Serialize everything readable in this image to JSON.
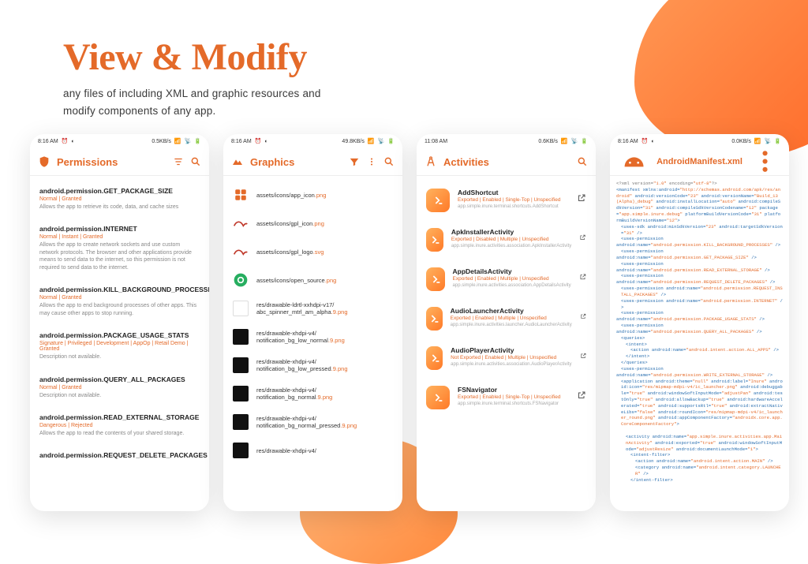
{
  "heading": "View & Modify",
  "subhead_line1": "any files of including XML and graphic resources and",
  "subhead_line2": "modify components of any app.",
  "status": {
    "time1": "8:16 AM",
    "time2": "8:16 AM",
    "time3": "11:08 AM",
    "time4": "8:16 AM",
    "speed1": "0.5KB/s",
    "speed2": "49.8KB/s",
    "speed3": "0.6KB/s",
    "speed4": "0.0KB/s"
  },
  "phone1": {
    "title": "Permissions",
    "items": [
      {
        "title": "android.permission.GET_PACKAGE_SIZE",
        "status": "Normal | Granted",
        "desc": "Allows the app to retrieve its code, data, and cache sizes"
      },
      {
        "title": "android.permission.INTERNET",
        "status": "Normal | Instant | Granted",
        "desc": "Allows the app to create network sockets and use custom network protocols. The browser and other applications provide means to send data to the internet, so this permission is not required to send data to the internet."
      },
      {
        "title": "android.permission.KILL_BACKGROUND_PROCESSES",
        "status": "Normal | Granted",
        "desc": "Allows the app to end background processes of other apps. This may cause other apps to stop running."
      },
      {
        "title": "android.permission.PACKAGE_USAGE_STATS",
        "status": "Signature | Privileged | Development | AppOp | Retail Demo | Granted",
        "desc": "Description not available."
      },
      {
        "title": "android.permission.QUERY_ALL_PACKAGES",
        "status": "Normal | Granted",
        "desc": "Description not available."
      },
      {
        "title": "android.permission.READ_EXTERNAL_STORAGE",
        "status": "Dangerous | Rejected",
        "desc": "Allows the app to read the contents of your shared storage."
      },
      {
        "title": "android.permission.REQUEST_DELETE_PACKAGES",
        "status": "",
        "desc": ""
      }
    ]
  },
  "phone2": {
    "title": "Graphics",
    "items": [
      {
        "thumb": "grid",
        "base": "assets/icons/app_icon",
        "ext": ".png",
        "nine": false
      },
      {
        "thumb": "bird",
        "base": "assets/icons/gpl_icon",
        "ext": ".png",
        "nine": false
      },
      {
        "thumb": "bird",
        "base": "assets/icons/gpl_logo",
        "ext": ".svg",
        "nine": false
      },
      {
        "thumb": "green",
        "base": "assets/icons/open_source",
        "ext": ".png",
        "nine": false
      },
      {
        "thumb": "empty",
        "base": "res/drawable-ldrtl-xxhdpi-v17/ abc_spinner_mtrl_am_alpha",
        "ext": ".png",
        "nine": true
      },
      {
        "thumb": "black",
        "base": "res/drawable-xhdpi-v4/ notification_bg_low_normal",
        "ext": ".png",
        "nine": true
      },
      {
        "thumb": "black",
        "base": "res/drawable-xhdpi-v4/ notification_bg_low_pressed",
        "ext": ".png",
        "nine": true
      },
      {
        "thumb": "black",
        "base": "res/drawable-xhdpi-v4/ notification_bg_normal",
        "ext": ".png",
        "nine": true
      },
      {
        "thumb": "black",
        "base": "res/drawable-xhdpi-v4/ notification_bg_normal_pressed",
        "ext": ".png",
        "nine": true
      },
      {
        "thumb": "black",
        "base": "res/drawable-xhdpi-v4/",
        "ext": "",
        "nine": false
      }
    ]
  },
  "phone3": {
    "title": "Activities",
    "items": [
      {
        "title": "AddShortcut",
        "status": "Exported | Enabled | Single-Top | Unspecified",
        "path": "app.simple.inure.terminal.shortcuts.AddShortcut"
      },
      {
        "title": "ApkInstallerActivity",
        "status": "Exported | Disabled | Multiple | Unspecified",
        "path": "app.simple.inure.activities.association.ApkInstallerActivity"
      },
      {
        "title": "AppDetailsActivity",
        "status": "Exported | Enabled | Multiple | Unspecified",
        "path": "app.simple.inure.activities.association.AppDetailsActivity"
      },
      {
        "title": "AudioLauncherActivity",
        "status": "Exported | Enabled | Multiple | Unspecified",
        "path": "app.simple.inure.activities.launcher.AudioLauncherActivity"
      },
      {
        "title": "AudioPlayerActivity",
        "status": "Not Exported | Enabled | Multiple | Unspecified",
        "path": "app.simple.inure.activities.association.AudioPlayerActivity"
      },
      {
        "title": "FSNavigator",
        "status": "Exported | Enabled | Single-Top | Unspecified",
        "path": "app.simple.inure.terminal.shortcuts.FSNavigator"
      }
    ]
  },
  "phone4": {
    "title": "AndroidManifest.xml",
    "xml": [
      {
        "indent": 0,
        "html": "<span class='xml-plain'>&lt;?xml version=</span><span class='xml-val'>\"1.0\"</span><span class='xml-plain'> encoding=</span><span class='xml-val'>\"utf-8\"</span><span class='xml-plain'>?&gt;</span>"
      },
      {
        "indent": 0,
        "html": "<span class='xml-tag'>&lt;manifest</span> <span class='xml-attr'>xmlns:android=</span><span class='xml-val'>\"http://schemas.android.com/apk/res/android\"</span> <span class='xml-attr'>android:versionCode=</span><span class='xml-val'>\"23\"</span> <span class='xml-attr'>android:versionName=</span><span class='xml-val'>\"Build_13 (Alpha)_debug\"</span> <span class='xml-attr'>android:installLocation=</span><span class='xml-val'>\"auto\"</span> <span class='xml-attr'>android:compileSdkVersion=</span><span class='xml-val'>\"31\"</span> <span class='xml-attr'>android:compileSdkVersionCodename=</span><span class='xml-val'>\"12\"</span> <span class='xml-attr'>package=</span><span class='xml-val'>\"app.simple.inure.debug\"</span> <span class='xml-attr'>platformBuildVersionCode=</span><span class='xml-val'>\"31\"</span> <span class='xml-attr'>platformBuildVersionName=</span><span class='xml-val'>\"12\"</span><span class='xml-tag'>&gt;</span>"
      },
      {
        "indent": 1,
        "html": "<span class='xml-tag'>&lt;uses-sdk</span> <span class='xml-attr'>android:minSdkVersion=</span><span class='xml-val'>\"23\"</span> <span class='xml-attr'>android:targetSdkVersion=</span><span class='xml-val'>\"31\"</span> <span class='xml-tag'>/&gt;</span>"
      },
      {
        "indent": 1,
        "html": "<span class='xml-tag'>&lt;uses-permission</span>"
      },
      {
        "indent": 0,
        "html": "<span class='xml-attr'>android:name=</span><span class='xml-val'>\"android.permission.KILL_BACKGROUND_PROCESSES\"</span> <span class='xml-tag'>/&gt;</span>"
      },
      {
        "indent": 1,
        "html": "<span class='xml-tag'>&lt;uses-permission</span>"
      },
      {
        "indent": 0,
        "html": "<span class='xml-attr'>android:name=</span><span class='xml-val'>\"android.permission.GET_PACKAGE_SIZE\"</span> <span class='xml-tag'>/&gt;</span>"
      },
      {
        "indent": 1,
        "html": "<span class='xml-tag'>&lt;uses-permission</span>"
      },
      {
        "indent": 0,
        "html": "<span class='xml-attr'>android:name=</span><span class='xml-val'>\"android.permission.READ_EXTERNAL_STORAGE\"</span> <span class='xml-tag'>/&gt;</span>"
      },
      {
        "indent": 1,
        "html": "<span class='xml-tag'>&lt;uses-permission</span>"
      },
      {
        "indent": 0,
        "html": "<span class='xml-attr'>android:name=</span><span class='xml-val'>\"android.permission.REQUEST_DELETE_PACKAGES\"</span> <span class='xml-tag'>/&gt;</span>"
      },
      {
        "indent": 1,
        "html": "<span class='xml-tag'>&lt;uses-permission</span> <span class='xml-attr'>android:name=</span><span class='xml-val'>\"android.permission.REQUEST_INSTALL_PACKAGES\"</span> <span class='xml-tag'>/&gt;</span>"
      },
      {
        "indent": 1,
        "html": "<span class='xml-tag'>&lt;uses-permission</span> <span class='xml-attr'>android:name=</span><span class='xml-val'>\"android.permission.INTERNET\"</span> <span class='xml-tag'>/&gt;</span>"
      },
      {
        "indent": 1,
        "html": "<span class='xml-tag'>&lt;uses-permission</span>"
      },
      {
        "indent": 0,
        "html": "<span class='xml-attr'>android:name=</span><span class='xml-val'>\"android.permission.PACKAGE_USAGE_STATS\"</span> <span class='xml-tag'>/&gt;</span>"
      },
      {
        "indent": 1,
        "html": "<span class='xml-tag'>&lt;uses-permission</span>"
      },
      {
        "indent": 0,
        "html": "<span class='xml-attr'>android:name=</span><span class='xml-val'>\"android.permission.QUERY_ALL_PACKAGES\"</span> <span class='xml-tag'>/&gt;</span>"
      },
      {
        "indent": 1,
        "html": "<span class='xml-tag'>&lt;queries&gt;</span>"
      },
      {
        "indent": 2,
        "html": "<span class='xml-tag'>&lt;intent&gt;</span>"
      },
      {
        "indent": 3,
        "html": "<span class='xml-tag'>&lt;action</span> <span class='xml-attr'>android:name=</span><span class='xml-val'>\"android.intent.action.ALL_APPS\"</span> <span class='xml-tag'>/&gt;</span>"
      },
      {
        "indent": 2,
        "html": "<span class='xml-tag'>&lt;/intent&gt;</span>"
      },
      {
        "indent": 1,
        "html": "<span class='xml-tag'>&lt;/queries&gt;</span>"
      },
      {
        "indent": 1,
        "html": "<span class='xml-tag'>&lt;uses-permission</span>"
      },
      {
        "indent": 0,
        "html": "<span class='xml-attr'>android:name=</span><span class='xml-val'>\"android.permission.WRITE_EXTERNAL_STORAGE\"</span> <span class='xml-tag'>/&gt;</span>"
      },
      {
        "indent": 1,
        "html": "<span class='xml-tag'>&lt;application</span> <span class='xml-attr'>android:theme=</span><span class='xml-val'>\"null\"</span> <span class='xml-attr'>android:label=</span><span class='xml-val'>\"Inure\"</span> <span class='xml-attr'>android:icon=</span><span class='xml-val'>\"res/mipmap-mdpi-v4/ic_launcher.png\"</span> <span class='xml-attr'>android:debuggable=</span><span class='xml-val'>\"true\"</span> <span class='xml-attr'>android:windowSoftInputMode=</span><span class='xml-val'>\"adjustPan\"</span> <span class='xml-attr'>android:testOnly=</span><span class='xml-val'>\"true\"</span> <span class='xml-attr'>android:allowBackup=</span><span class='xml-val'>\"true\"</span> <span class='xml-attr'>android:hardwareAccelerated=</span><span class='xml-val'>\"true\"</span> <span class='xml-attr'>android:supportsRtl=</span><span class='xml-val'>\"true\"</span> <span class='xml-attr'>android:extractNativeLibs=</span><span class='xml-val'>\"false\"</span> <span class='xml-attr'>android:roundIcon=</span><span class='xml-val'>\"res/mipmap-mdpi-v4/ic_launcher_round.png\"</span> <span class='xml-attr'>android:appComponentFactory=</span><span class='xml-val'>\"androidx.core.app.CoreComponentFactory\"</span><span class='xml-tag'>&gt;</span>"
      },
      {
        "indent": 0,
        "html": "&nbsp;"
      },
      {
        "indent": 2,
        "html": "<span class='xml-tag'>&lt;activity</span> <span class='xml-attr'>android:name=</span><span class='xml-val'>\"app.simple.inure.activities.app.MainActivity\"</span> <span class='xml-attr'>android:exported=</span><span class='xml-val'>\"true\"</span> <span class='xml-attr'>android:windowSoftInputMode=</span><span class='xml-val'>\"adjustResize\"</span> <span class='xml-attr'>android:documentLaunchMode=</span><span class='xml-val'>\"1\"</span><span class='xml-tag'>&gt;</span>"
      },
      {
        "indent": 3,
        "html": "<span class='xml-tag'>&lt;intent-filter&gt;</span>"
      },
      {
        "indent": 4,
        "html": "<span class='xml-tag'>&lt;action</span> <span class='xml-attr'>android:name=</span><span class='xml-val'>\"android.intent.action.MAIN\"</span> <span class='xml-tag'>/&gt;</span>"
      },
      {
        "indent": 4,
        "html": "<span class='xml-tag'>&lt;category</span> <span class='xml-attr'>android:name=</span><span class='xml-val'>\"android.intent.category.LAUNCHER\"</span> <span class='xml-tag'>/&gt;</span>"
      },
      {
        "indent": 3,
        "html": "<span class='xml-tag'>&lt;/intent-filter&gt;</span>"
      }
    ]
  }
}
